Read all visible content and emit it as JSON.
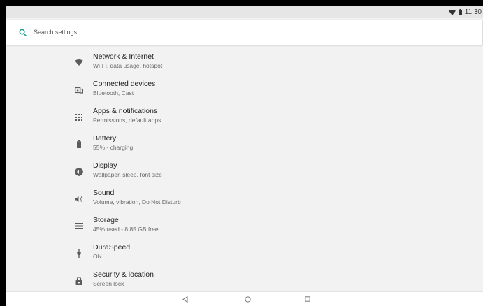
{
  "status_bar": {
    "time": "11:30",
    "icons": [
      "wifi-icon",
      "battery-icon"
    ]
  },
  "search": {
    "placeholder": "Search settings",
    "icon": "search-icon",
    "accent_color": "#1a9e8f"
  },
  "settings": [
    {
      "title": "Network & Internet",
      "subtitle": "Wi-Fi, data usage, hotspot",
      "icon": "wifi-icon"
    },
    {
      "title": "Connected devices",
      "subtitle": "Bluetooth, Cast",
      "icon": "devices-icon"
    },
    {
      "title": "Apps & notifications",
      "subtitle": "Permissions, default apps",
      "icon": "apps-grid-icon"
    },
    {
      "title": "Battery",
      "subtitle": "55% - charging",
      "icon": "battery-icon"
    },
    {
      "title": "Display",
      "subtitle": "Wallpaper, sleep, font size",
      "icon": "brightness-icon"
    },
    {
      "title": "Sound",
      "subtitle": "Volume, vibration, Do Not Disturb",
      "icon": "volume-icon"
    },
    {
      "title": "Storage",
      "subtitle": "45% used - 8.85 GB free",
      "icon": "storage-icon"
    },
    {
      "title": "DuraSpeed",
      "subtitle": "ON",
      "icon": "duraspeed-icon"
    },
    {
      "title": "Security & location",
      "subtitle": "Screen lock",
      "icon": "lock-icon"
    }
  ],
  "navigation": {
    "buttons": [
      "back-icon",
      "home-icon",
      "recents-icon"
    ]
  }
}
